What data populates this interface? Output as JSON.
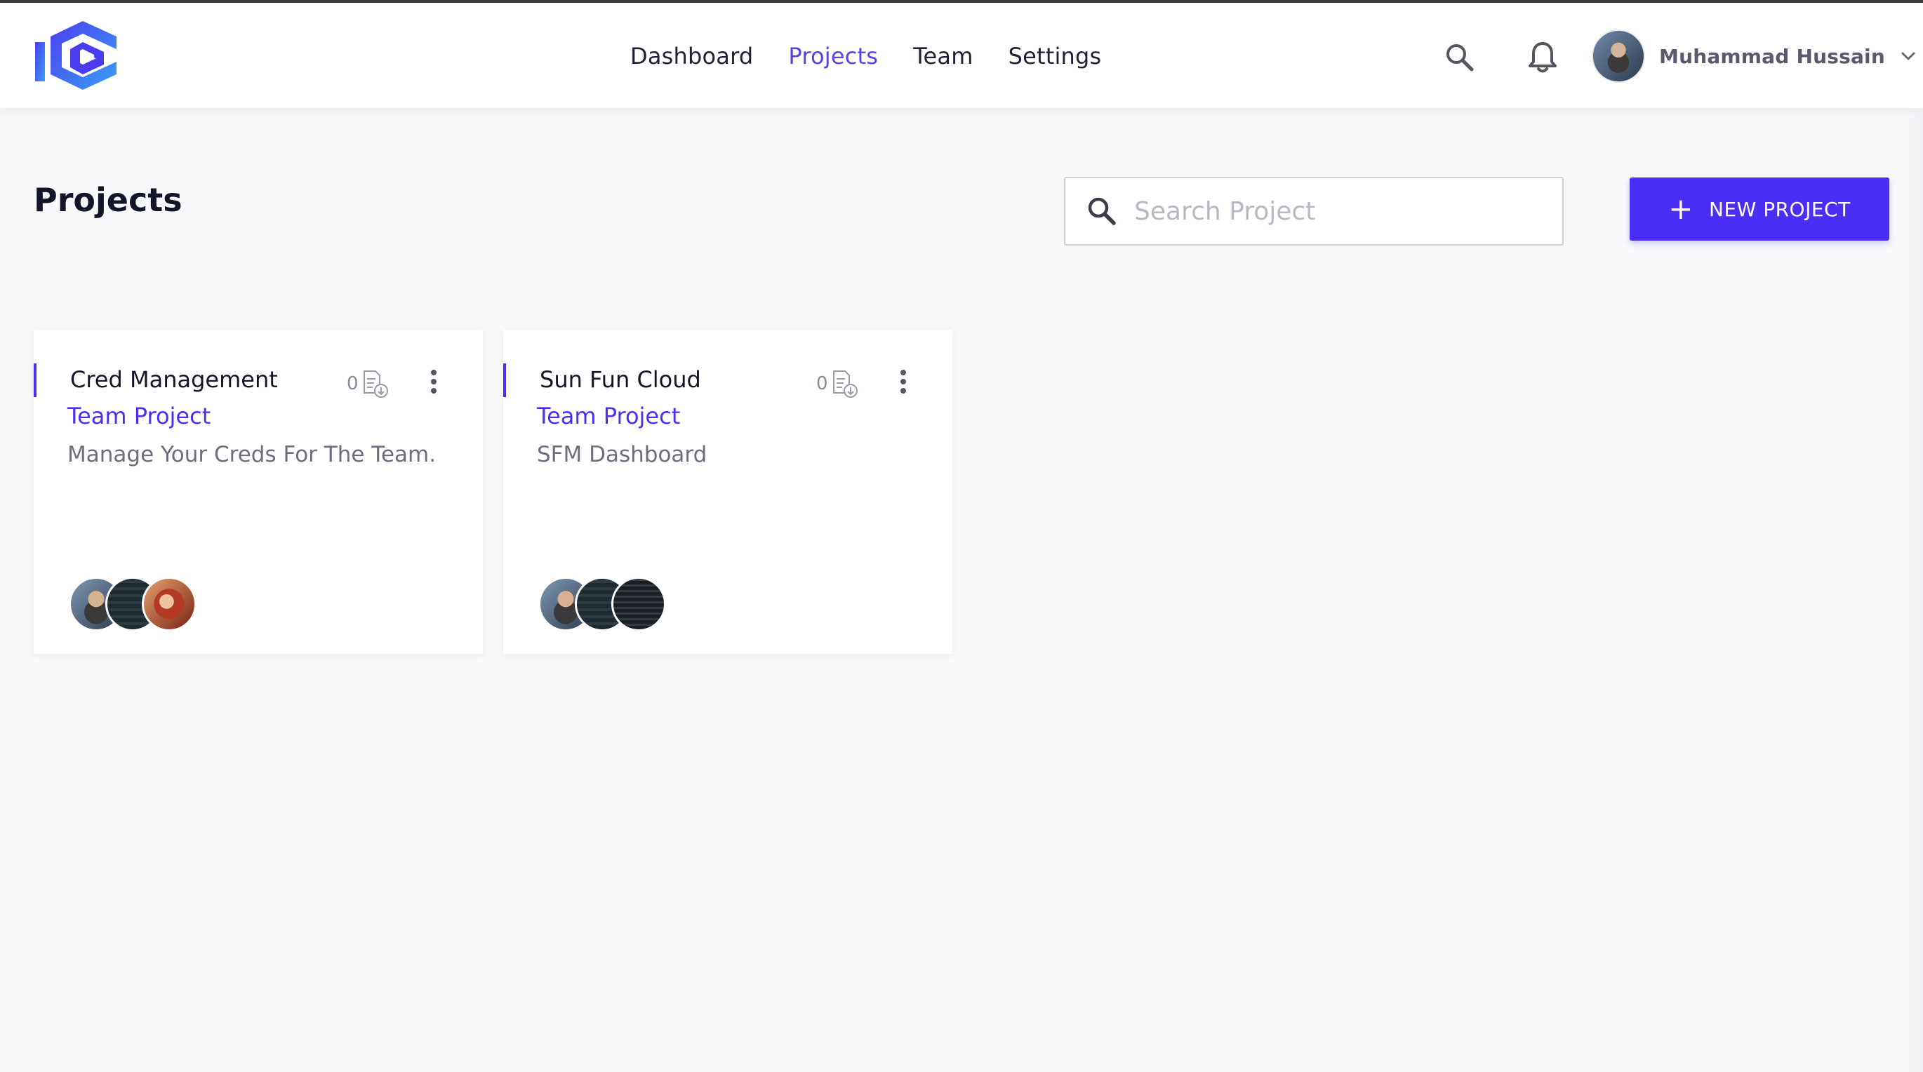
{
  "nav": {
    "links": [
      "Dashboard",
      "Projects",
      "Team",
      "Settings"
    ],
    "active": "Projects"
  },
  "user": {
    "name": "Muhammad Hussain"
  },
  "page": {
    "title": "Projects",
    "search_placeholder": "Search Project",
    "new_button_label": "NEW PROJECT"
  },
  "projects": [
    {
      "title": "Cred Management",
      "type": "Team Project",
      "description": "Manage Your Creds For The Team.",
      "count": "0",
      "members": 3
    },
    {
      "title": "Sun Fun Cloud",
      "type": "Team Project",
      "description": "SFM Dashboard",
      "count": "0",
      "members": 3
    }
  ],
  "colors": {
    "accent": "#4a2ef5",
    "active_nav": "#5b40e6"
  },
  "icons": [
    "logo-icon",
    "search-icon",
    "bell-icon",
    "chevron-down-icon",
    "plus-icon",
    "document-download-icon",
    "kebab-menu-icon"
  ]
}
